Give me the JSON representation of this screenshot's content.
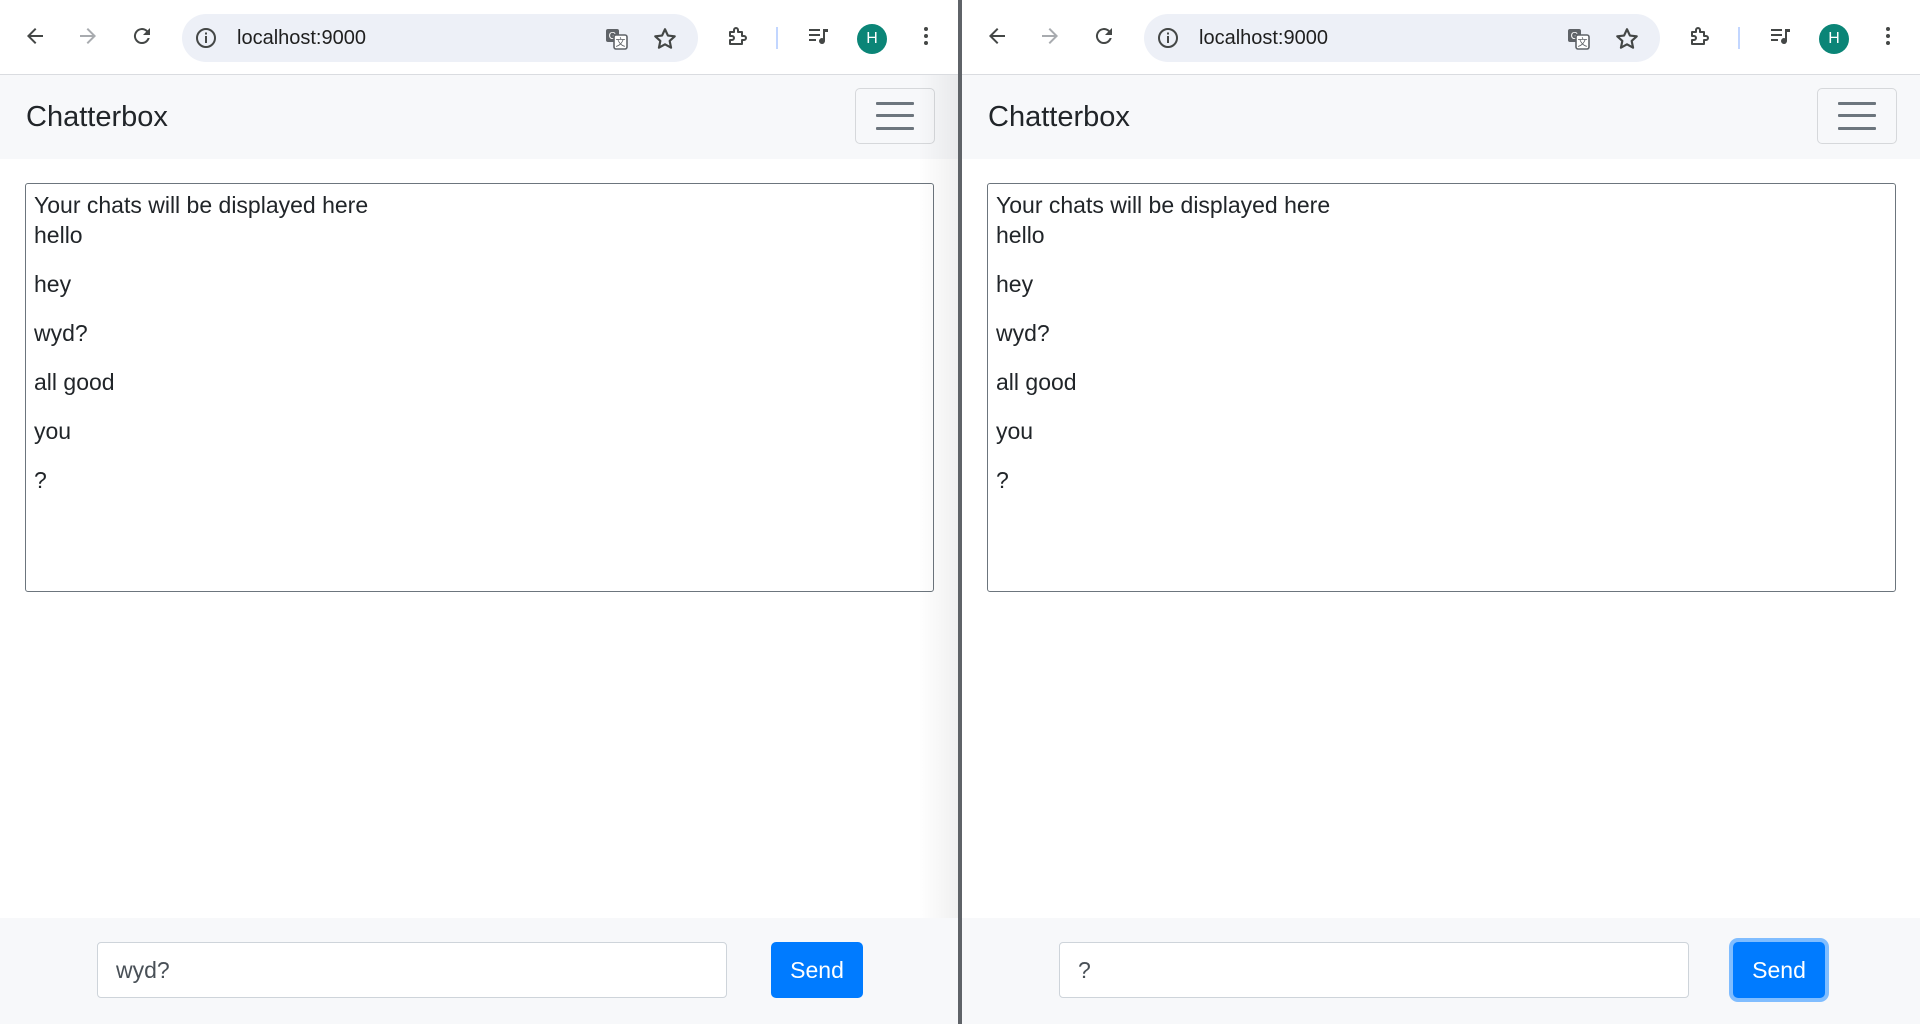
{
  "windows": [
    {
      "id": "left",
      "browser": {
        "url": "localhost:9000",
        "avatar_letter": "H"
      },
      "app": {
        "brand": "Chatterbox",
        "chat_header": "Your chats will be displayed here",
        "messages": [
          "hello",
          "hey",
          "wyd?",
          "all good",
          "you",
          "?"
        ],
        "input_value": "wyd?",
        "send_label": "Send"
      }
    },
    {
      "id": "right",
      "browser": {
        "url": "localhost:9000",
        "avatar_letter": "H"
      },
      "app": {
        "brand": "Chatterbox",
        "chat_header": "Your chats will be displayed here",
        "messages": [
          "hello",
          "hey",
          "wyd?",
          "all good",
          "you",
          "?"
        ],
        "input_value": "?",
        "send_label": "Send"
      }
    }
  ],
  "icons": {
    "back": "back-arrow-icon",
    "forward": "forward-arrow-icon",
    "reload": "reload-icon",
    "site_info": "info-icon",
    "translate": "translate-icon",
    "bookmark": "star-icon",
    "extensions": "puzzle-piece-icon",
    "media": "media-control-icon",
    "menu": "kebab-menu-icon",
    "nav_toggle": "hamburger-icon"
  },
  "colors": {
    "primary": "#007bff",
    "focus_ring": "#80bdff",
    "navbar_bg": "#f7f8fa",
    "avatar": "#0b8577",
    "omnibox": "#edf0f7"
  }
}
